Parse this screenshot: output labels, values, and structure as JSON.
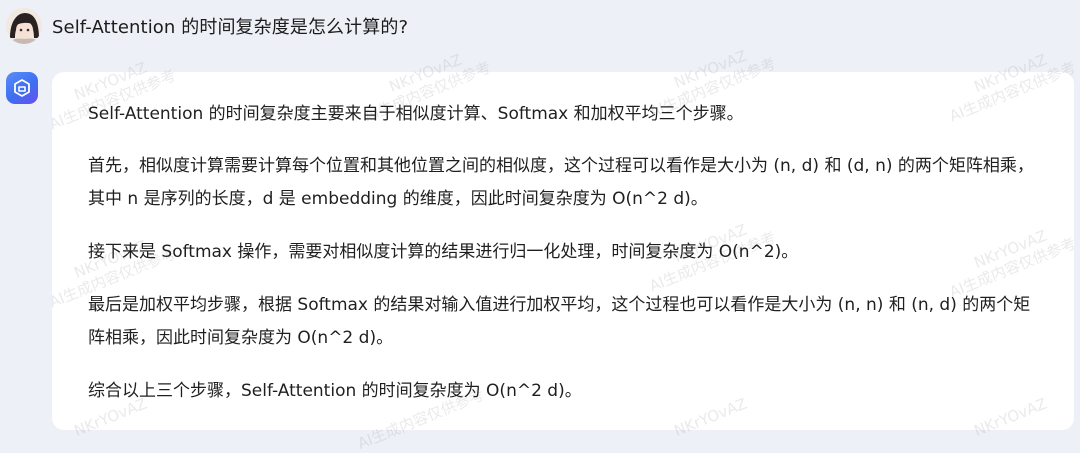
{
  "user": {
    "question": "Self-Attention 的时间复杂度是怎么计算的?"
  },
  "assistant": {
    "paragraphs": [
      "Self-Attention 的时间复杂度主要来自于相似度计算、Softmax 和加权平均三个步骤。",
      "首先，相似度计算需要计算每个位置和其他位置之间的相似度，这个过程可以看作是大小为 (n, d) 和 (d, n) 的两个矩阵相乘，其中 n 是序列的长度，d 是 embedding 的维度，因此时间复杂度为 O(n^2 d)。",
      "接下来是 Softmax 操作，需要对相似度计算的结果进行归一化处理，时间复杂度为 O(n^2)。",
      "最后是加权平均步骤，根据 Softmax 的结果对输入值进行加权平均，这个过程也可以看作是大小为 (n, n) 和 (n, d) 的两个矩阵相乘，因此时间复杂度为 O(n^2 d)。",
      "综合以上三个步骤，Self-Attention 的时间复杂度为 O(n^2 d)。"
    ]
  },
  "watermark": {
    "id": "NKrYOvAZ",
    "note": "AI生成内容仅供参考"
  },
  "colors": {
    "page_background": "#eef0f7",
    "card_background": "#ffffff",
    "text": "#1f1f1f",
    "bot_avatar": "#4a7af2"
  },
  "icons": {
    "user_avatar": "anime-avatar",
    "bot_avatar": "cube-logo-icon"
  }
}
